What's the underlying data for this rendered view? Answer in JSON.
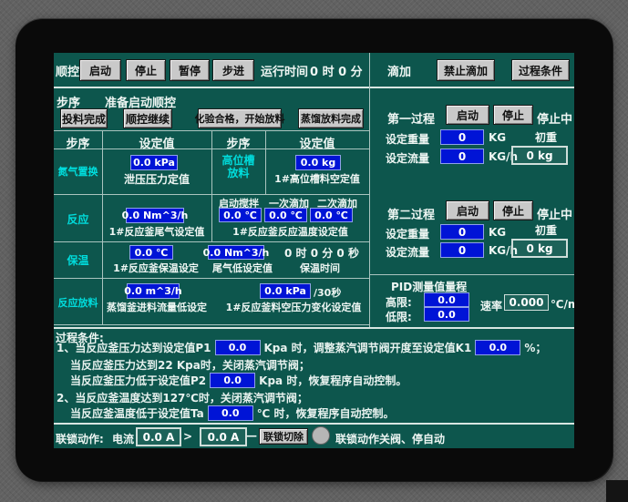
{
  "colors": {
    "screen_bg": "#0d564d",
    "field_blue": "#0014d6",
    "accent_cyan": "#00dcdc",
    "button_gray": "#c9c9c9"
  },
  "seq": {
    "label": "顺控",
    "start": "启动",
    "stop": "停止",
    "pause": "暂停",
    "step": "步进",
    "runtime_label": "运行时间",
    "runtime_value": "0 时 0 分"
  },
  "drip": {
    "label": "滴加",
    "forbid": "禁止滴加",
    "process_cond": "过程条件"
  },
  "step_status": {
    "label": "步序",
    "value": "准备启动顺控"
  },
  "actions": {
    "feed_done": "投料完成",
    "seq_continue": "顺控继续",
    "test_ok": "化验合格，开始放料",
    "distill_done": "蒸馏放料完成"
  },
  "table": {
    "h1": "步序",
    "h2": "设定值",
    "h3": "步序",
    "h4": "设定值",
    "r1": {
      "label": "氮气置换",
      "f1": "0.0 kPa",
      "l1": "泄压压力定值",
      "label2a": "高位槽",
      "label2b": "放料",
      "f2": "0.0 kg",
      "l2": "1#高位槽料空定值"
    },
    "r2": {
      "label": "反应",
      "f1": "0.0 Nm^3/h",
      "l1": "1#反应釜尾气设定值",
      "s1": "启动搅拌",
      "s2": "一次滴加",
      "s3": "二次滴加",
      "t1": "0.0 ℃",
      "t2": "0.0 ℃",
      "t3": "0.0 ℃",
      "l2": "1#反应釜反应温度设定值"
    },
    "r3": {
      "label": "保温",
      "f1": "0.0 ℃",
      "l1": "1#反应釜保温设定",
      "f2": "0.0 Nm^3/h",
      "l2": "尾气低设定值",
      "time": "0 时 0 分 0 秒",
      "l3": "保温时间"
    },
    "r4": {
      "label": "反应放料",
      "f1": "0.0 m^3/h",
      "l1": "蒸馏釜进料流量低设定",
      "f2": "0.0 kPa",
      "suffix": "/30秒",
      "l2": "1#反应釜料空压力变化设定值"
    }
  },
  "process1": {
    "title": "第一过程",
    "start": "启动",
    "stop": "停止",
    "status": "停止中",
    "w_label": "设定重量",
    "w_value": "0",
    "w_unit": "KG",
    "init_label": "初重",
    "f_label": "设定流量",
    "f_value": "0",
    "f_unit": "KG/h",
    "init_value": "0 kg"
  },
  "process2": {
    "title": "第二过程",
    "start": "启动",
    "stop": "停止",
    "status": "停止中",
    "w_label": "设定重量",
    "w_value": "0",
    "w_unit": "KG",
    "init_label": "初重",
    "f_label": "设定流量",
    "f_value": "0",
    "f_unit": "KG/h",
    "init_value": "0 kg"
  },
  "pid": {
    "title": "PID测量值量程",
    "high_label": "高限:",
    "high_value": "0.0",
    "low_label": "低限:",
    "low_value": "0.0",
    "rate_label": "速率",
    "rate_value": "0.000",
    "rate_unit": "℃/m"
  },
  "conditions": {
    "title": "过程条件:",
    "l1a": "1、当反应釜压力达到设定值P1",
    "l1v": "0.0",
    "l1b": "Kpa 时，调整蒸汽调节阀开度至设定值K1",
    "l1v2": "0.0",
    "l1c": "%；",
    "l2": "当反应釜压力达到22 Kpa时，关闭蒸汽调节阀；",
    "l3a": "当反应釜压力低于设定值P2",
    "l3v": "0.0",
    "l3b": "Kpa 时，恢复程序自动控制。",
    "l4": "2、当反应釜温度达到127℃时，关闭蒸汽调节阀；",
    "l5a": "当反应釜温度低于设定值Ta",
    "l5v": "0.0",
    "l5b": "℃ 时，恢复程序自动控制。"
  },
  "interlock": {
    "label": "联锁动作:",
    "current": "电流",
    "v1": "0.0 A",
    "gt": ">",
    "v2": "0.0 A",
    "dash": "—",
    "cut": "联锁切除",
    "text": "联锁动作关阀、停自动"
  }
}
